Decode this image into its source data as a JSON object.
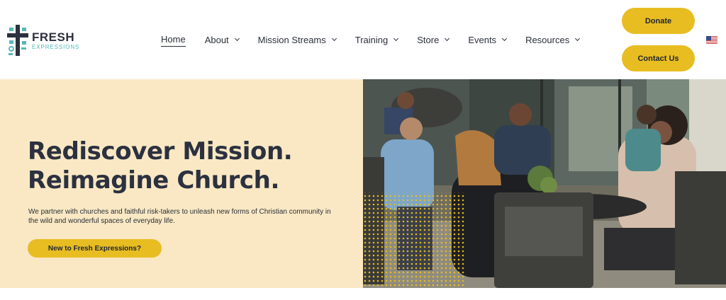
{
  "logo": {
    "primary": "FRESH",
    "secondary": "EXPRESSIONS"
  },
  "nav": [
    {
      "label": "Home",
      "active": true,
      "dropdown": false
    },
    {
      "label": "About",
      "dropdown": true
    },
    {
      "label": "Mission Streams",
      "dropdown": true
    },
    {
      "label": "Training",
      "dropdown": true
    },
    {
      "label": "Store",
      "dropdown": true
    },
    {
      "label": "Events",
      "dropdown": true
    },
    {
      "label": "Resources",
      "dropdown": true
    }
  ],
  "header_buttons": {
    "donate": "Donate",
    "contact": "Contact Us"
  },
  "language_flag": "us-flag-icon",
  "hero": {
    "title_line1": "Rediscover Mission.",
    "title_line2": "Reimagine Church.",
    "description": "We partner with churches and faithful risk-takers to unleash new forms of Christian community in the wild and wonderful spaces of everyday life.",
    "cta": "New to Fresh Expressions?"
  },
  "colors": {
    "accent": "#e8bd22",
    "hero_bg": "#f9e8c3",
    "text": "#2c3140",
    "logo_teal": "#55b8b6"
  }
}
